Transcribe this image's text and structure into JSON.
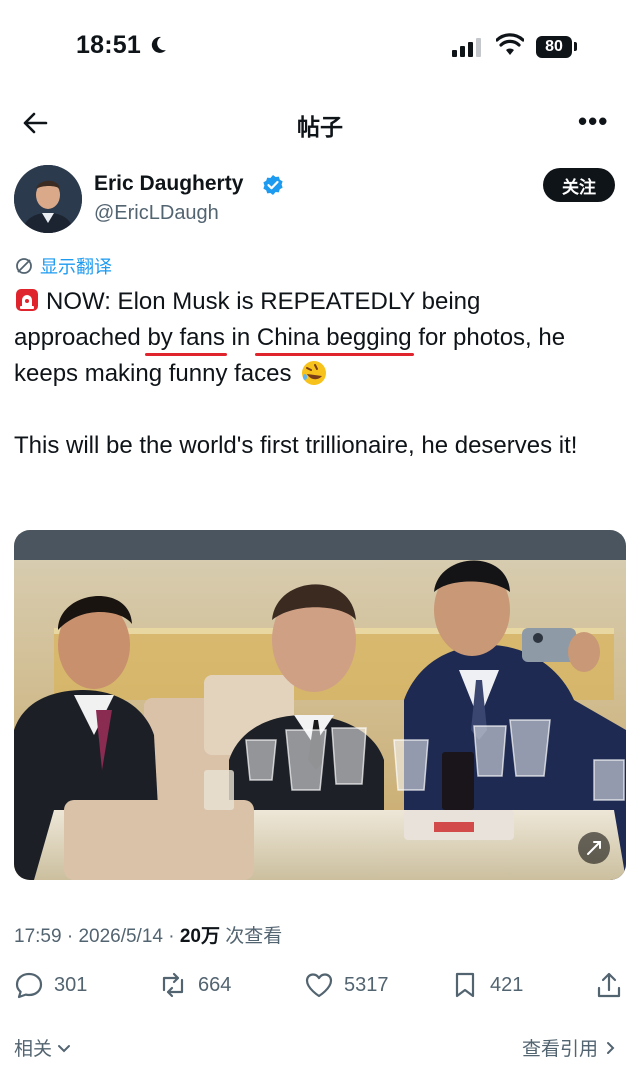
{
  "status_bar": {
    "time": "18:51",
    "battery": "80"
  },
  "nav": {
    "title": "帖子"
  },
  "author": {
    "name": "Eric Daugherty",
    "handle": "@EricLDaugh",
    "follow_label": "关注"
  },
  "translate": {
    "label": "显示翻译"
  },
  "tweet": {
    "line1_a": "NOW: Elon Musk is REPEATEDLY being",
    "line2_a": "approached ",
    "hl1": "by fans",
    "line2_b": " in ",
    "hl2": "China begging",
    "line2_c": " for photos, he",
    "line3": "keeps making funny faces",
    "para2": "This will be the world's first trillionaire, he deserves it!"
  },
  "meta": {
    "time": "17:59",
    "date": "2026/5/14",
    "views_count": "20万",
    "views_label": "次查看",
    "sep": "·"
  },
  "actions": {
    "replies": "301",
    "reposts": "664",
    "likes": "5317",
    "bookmarks": "421"
  },
  "footer": {
    "related": "相关",
    "view_quotes": "查看引用"
  },
  "colors": {
    "link": "#1d9bf0",
    "underline": "#e0242e",
    "text": "#0f1419",
    "muted": "#536471"
  },
  "icons": [
    "moon-icon",
    "signal-icon",
    "wifi-icon",
    "back-arrow-icon",
    "more-icon",
    "verified-icon",
    "translate-icon",
    "siren-emoji",
    "rofl-emoji",
    "reply-icon",
    "repost-icon",
    "like-icon",
    "bookmark-icon",
    "share-icon",
    "chevron-down-icon",
    "chevron-right-icon",
    "alt-text-icon"
  ]
}
